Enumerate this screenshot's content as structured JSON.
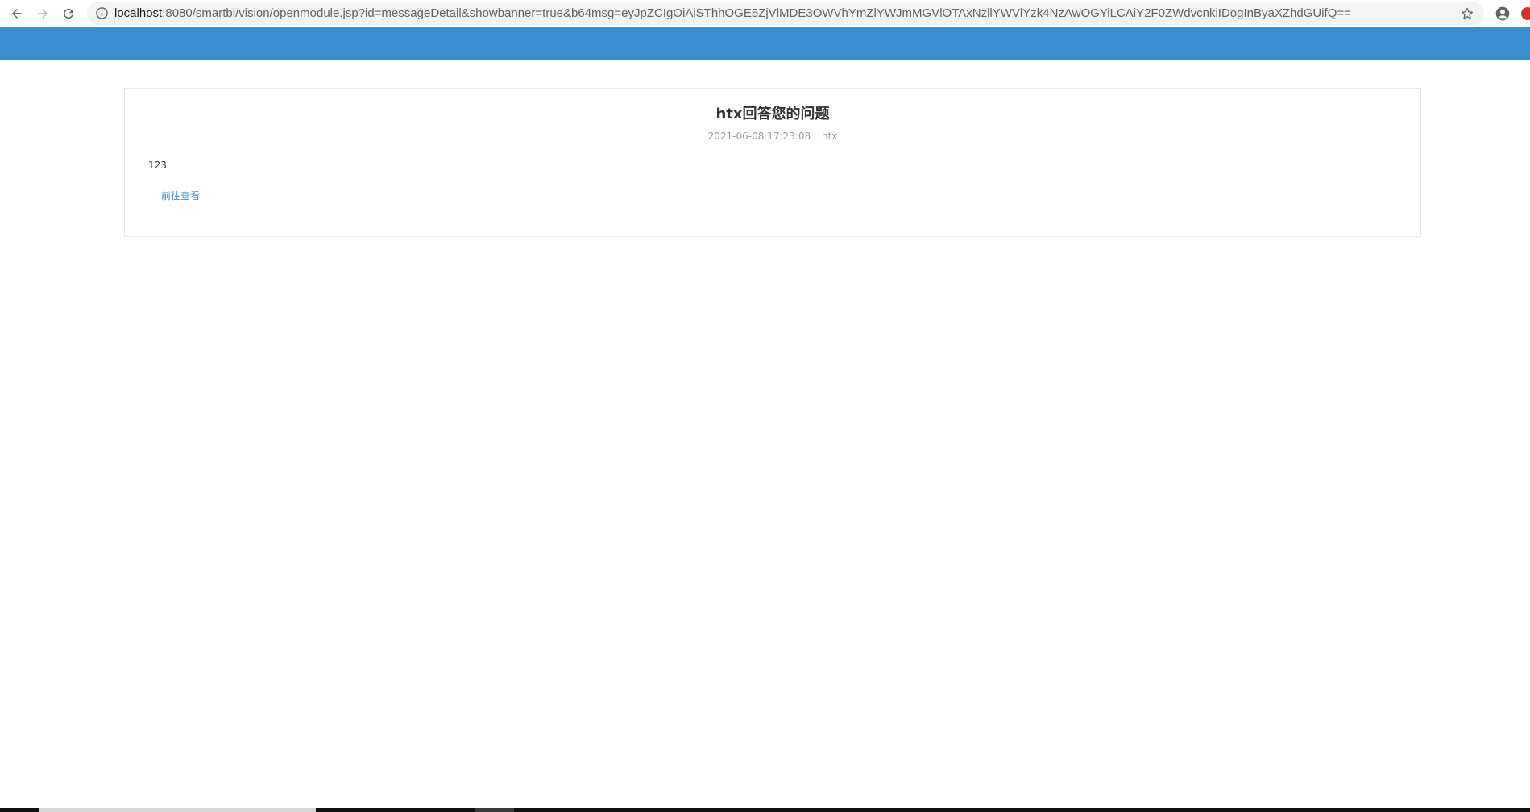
{
  "browser": {
    "url_host": "localhost",
    "url_rest": ":8080/smartbi/vision/openmodule.jsp?id=messageDetail&showbanner=true&b64msg=eyJpZCIgOiAiSThhOGE5ZjVlMDE3OWVhYmZlYWJmMGVlOTAxNzllYWVlYzk4NzAwOGYiLCAiY2F0ZWdvcnkiIDogInByaXZhdGUifQ=="
  },
  "message": {
    "title": "htx回答您的问题",
    "date": "2021-06-08 17:23:08",
    "author": "htx",
    "body": "123",
    "link_label": "前往查看"
  },
  "colors": {
    "banner": "#3a8ed0",
    "link": "#3a8ed0"
  }
}
